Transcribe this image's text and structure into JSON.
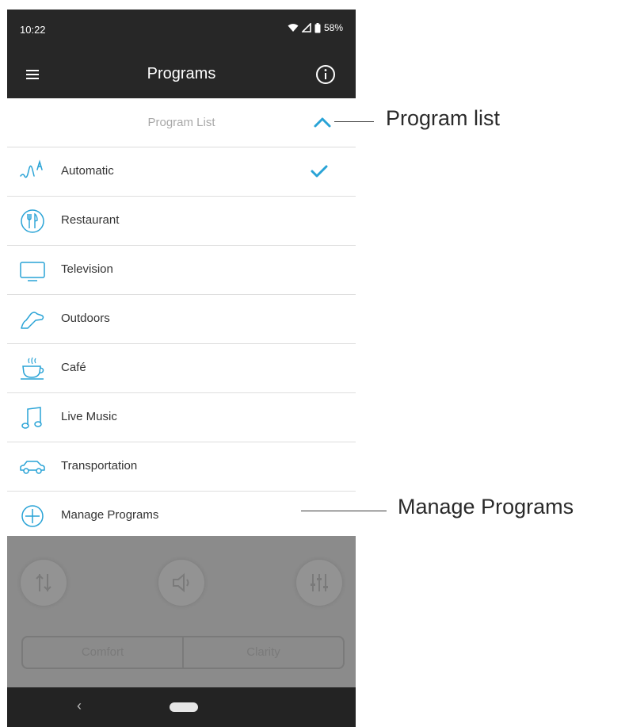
{
  "status_bar": {
    "time": "10:22",
    "battery": "58%"
  },
  "app_bar": {
    "title": "Programs"
  },
  "program_list": {
    "header_label": "Program List",
    "items": [
      {
        "label": "Automatic",
        "icon": "automatic-icon",
        "selected": true
      },
      {
        "label": "Restaurant",
        "icon": "restaurant-icon",
        "selected": false
      },
      {
        "label": "Television",
        "icon": "television-icon",
        "selected": false
      },
      {
        "label": "Outdoors",
        "icon": "outdoors-icon",
        "selected": false
      },
      {
        "label": "Café",
        "icon": "cafe-icon",
        "selected": false
      },
      {
        "label": "Live Music",
        "icon": "music-icon",
        "selected": false
      },
      {
        "label": "Transportation",
        "icon": "car-icon",
        "selected": false
      },
      {
        "label": "Manage Programs",
        "icon": "plus-circle-icon",
        "selected": false
      }
    ]
  },
  "bottom_controls": {
    "segments": [
      "Comfort",
      "Clarity"
    ]
  },
  "nav_bar": {
    "back_glyph": "‹"
  },
  "callouts": {
    "program_list": "Program list",
    "manage_programs": "Manage Programs"
  },
  "colors": {
    "accent": "#29a3d6",
    "bar": "#272727",
    "dim": "#8b8b8b"
  }
}
